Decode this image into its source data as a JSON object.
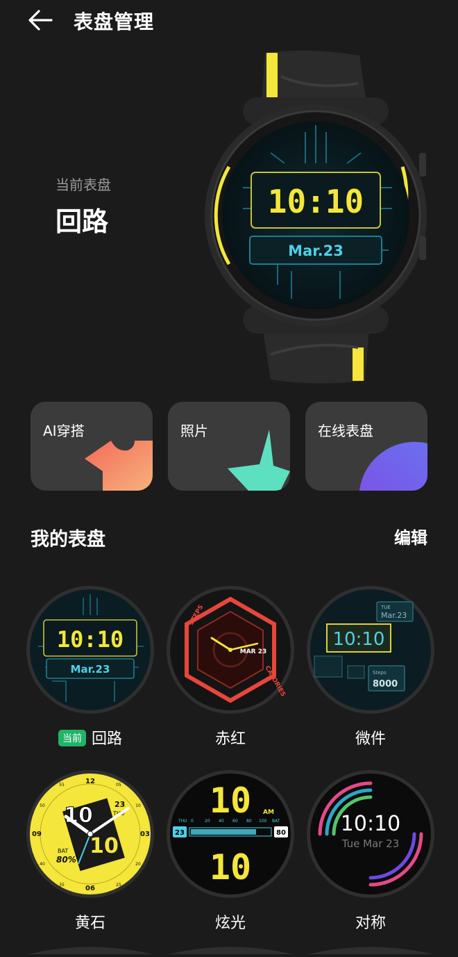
{
  "header": {
    "title": "表盘管理"
  },
  "current": {
    "label": "当前表盘",
    "name": "回路"
  },
  "hero_face": {
    "time": "10:10",
    "date": "Mar.23"
  },
  "cards": [
    {
      "label": "AI穿搭"
    },
    {
      "label": "照片"
    },
    {
      "label": "在线表盘"
    }
  ],
  "my_faces": {
    "title": "我的表盘",
    "edit_label": "编辑",
    "current_badge": "当前",
    "items": [
      {
        "name": "回路",
        "time": "10:10",
        "date": "Mar.23"
      },
      {
        "name": "赤红",
        "date": "MAR 23",
        "steps_label": "STEPS",
        "calories_label": "CALORIES"
      },
      {
        "name": "微件",
        "time": "10:10",
        "date_day": "TUE",
        "date": "Mar.23",
        "steps_label": "Steps",
        "steps": "8000"
      },
      {
        "name": "黄石",
        "hour": "10",
        "minute": "10",
        "day": "23",
        "weekday": "THU",
        "bat_label": "BAT",
        "bat": "80%",
        "ticks": [
          "12",
          "03",
          "06",
          "09",
          "55",
          "05",
          "10",
          "15",
          "20",
          "25",
          "35",
          "40",
          "45",
          "50"
        ]
      },
      {
        "name": "炫光",
        "hour": "10",
        "minute": "10",
        "ampm": "AM",
        "day_label": "THU",
        "day": "23",
        "bat": "80",
        "scale": [
          "0",
          "20",
          "40",
          "60",
          "80",
          "100",
          "BAT"
        ]
      },
      {
        "name": "对称",
        "time": "10:10",
        "date": "Tue  Mar 23"
      }
    ]
  },
  "colors": {
    "yellow": "#f4e63a",
    "cyan": "#4fd0e8",
    "red": "#e8463a",
    "green": "#21b36a",
    "card": "#3b3b3b"
  }
}
